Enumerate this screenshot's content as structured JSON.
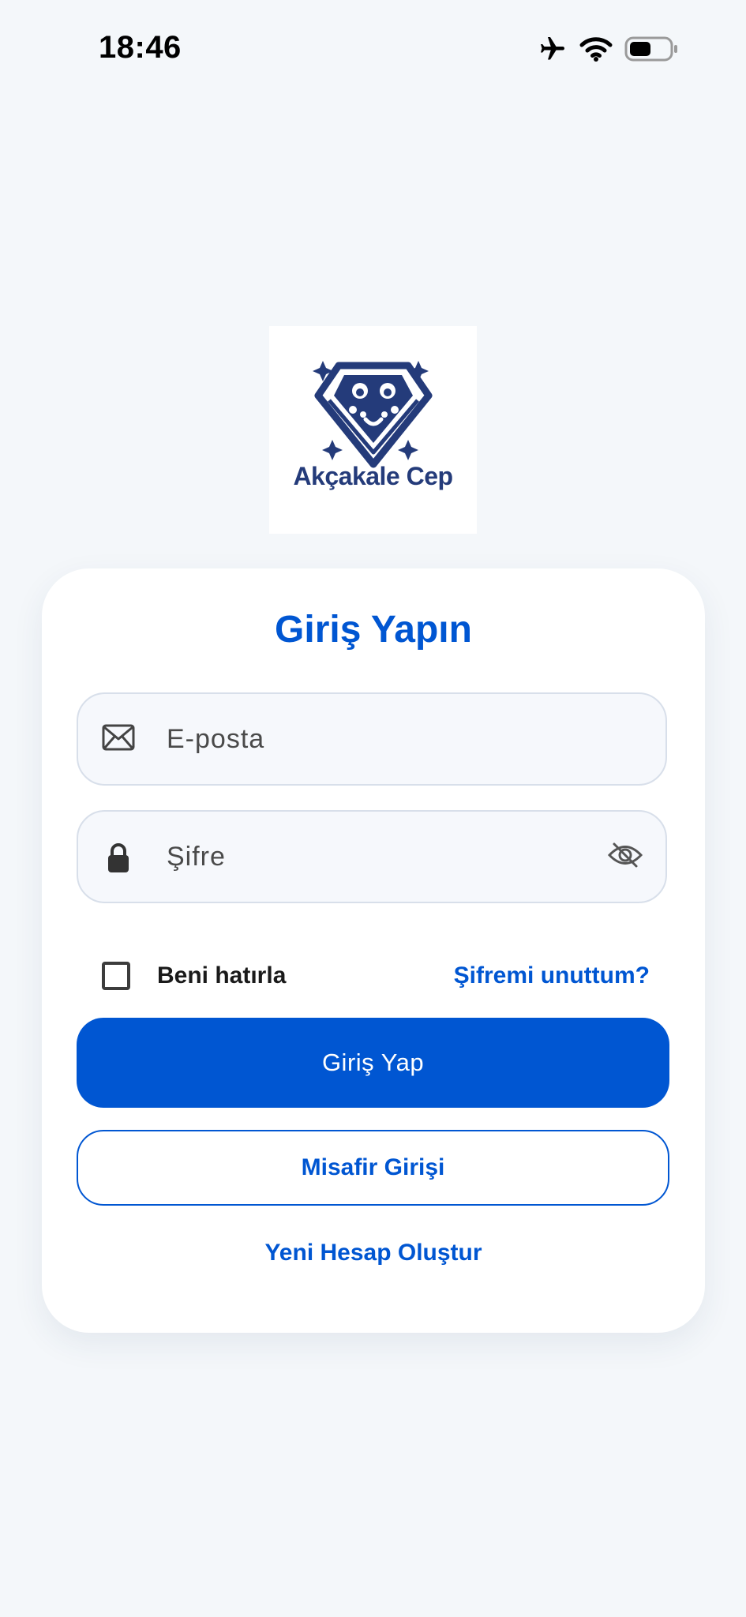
{
  "status_bar": {
    "time": "18:46",
    "icons": [
      "airplane-icon",
      "wifi-icon",
      "battery-icon"
    ]
  },
  "logo": {
    "text": "Akçakale Cep",
    "icon": "diamond-mascot-icon"
  },
  "login": {
    "title": "Giriş Yapın",
    "email_placeholder": "E-posta",
    "email_value": "",
    "password_placeholder": "Şifre",
    "password_value": "",
    "remember_label": "Beni hatırla",
    "remember_checked": false,
    "forgot_label": "Şifremi unuttum?",
    "submit_label": "Giriş Yap",
    "guest_label": "Misafir Girişi",
    "register_label": "Yeni Hesap Oluştur"
  },
  "colors": {
    "primary": "#0056d2",
    "background": "#f4f7fa",
    "card": "#ffffff",
    "logo_navy": "#243b7a"
  }
}
